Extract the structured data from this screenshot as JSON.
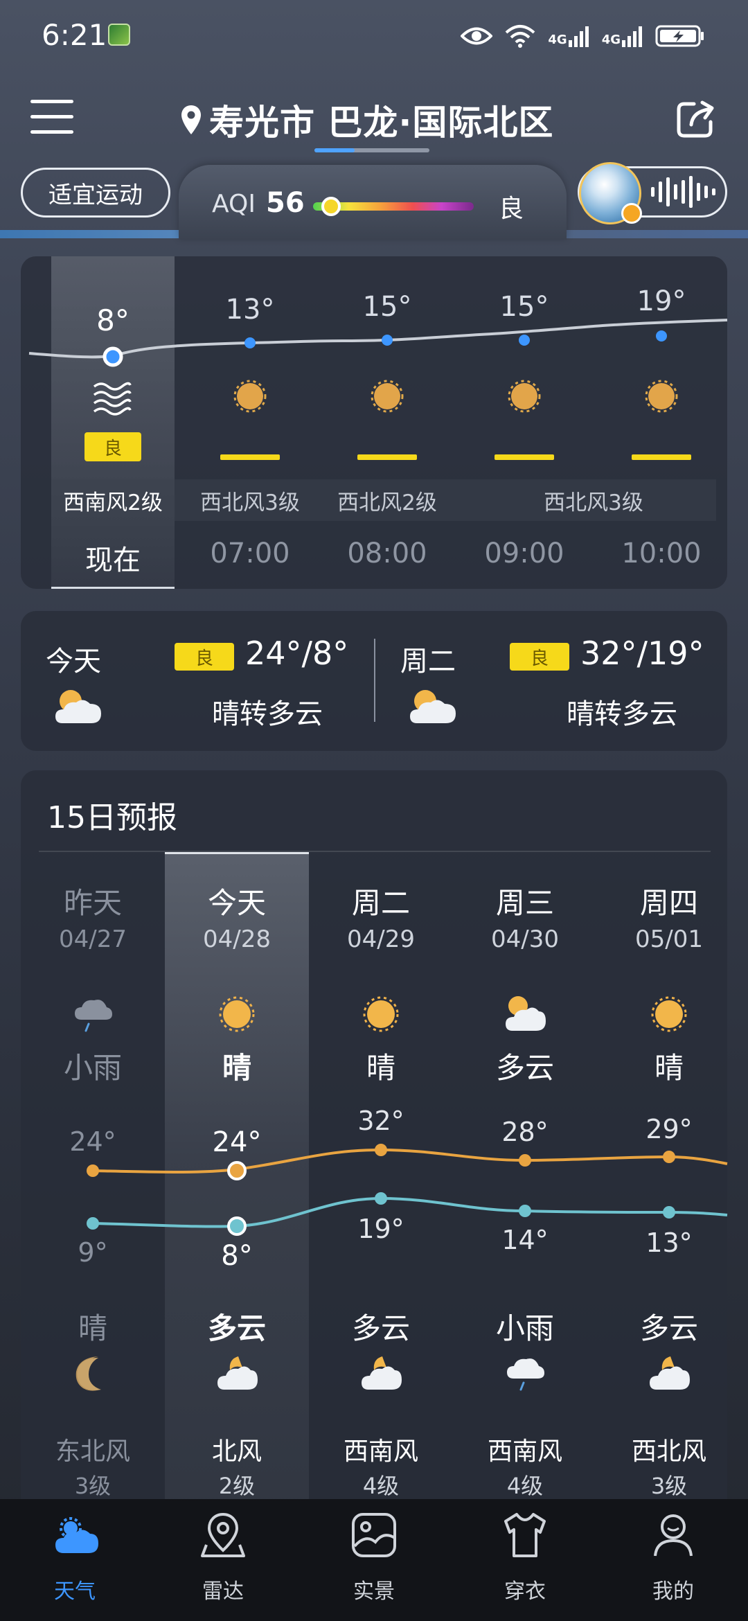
{
  "status_bar": {
    "time": "6:21",
    "network_labels": [
      "4G",
      "4G"
    ],
    "icons": [
      "eye-icon",
      "wifi-icon",
      "signal-icon",
      "signal-icon",
      "battery-charging-icon"
    ]
  },
  "header": {
    "location": "寿光市 巴龙·国际北区",
    "menu_icon": "menu-icon",
    "share_icon": "share-icon"
  },
  "aqi": {
    "sport_label": "适宜运动",
    "label": "AQI",
    "value": "56",
    "level": "良",
    "scale_position": 0.11
  },
  "hourly": {
    "items": [
      {
        "temp": "8°",
        "wind": "西南风2级",
        "time": "现在",
        "aqi": "良",
        "icon": "haze-icon"
      },
      {
        "temp": "13°",
        "wind": "西北风3级",
        "time": "07:00",
        "icon": "sun-icon"
      },
      {
        "temp": "15°",
        "wind": "西北风2级",
        "time": "08:00",
        "icon": "sun-icon"
      },
      {
        "temp": "15°",
        "wind": "西北风3级",
        "time": "09:00",
        "icon": "sun-icon"
      },
      {
        "temp": "19°",
        "time": "10:00",
        "icon": "sun-icon"
      }
    ]
  },
  "summary": {
    "today": {
      "day": "今天",
      "aqi": "良",
      "temp": "24°/8°",
      "condition": "晴转多云"
    },
    "tomorrow": {
      "day": "周二",
      "aqi": "良",
      "temp": "32°/19°",
      "condition": "晴转多云"
    }
  },
  "forecast": {
    "title": "15日预报",
    "days": [
      {
        "day": "昨天",
        "date": "04/27",
        "day_cond": "小雨",
        "high": "24°",
        "low": "9°",
        "night_cond": "晴",
        "wind": "东北风",
        "level": "3级"
      },
      {
        "day": "今天",
        "date": "04/28",
        "day_cond": "晴",
        "high": "24°",
        "low": "8°",
        "night_cond": "多云",
        "wind": "北风",
        "level": "2级"
      },
      {
        "day": "周二",
        "date": "04/29",
        "day_cond": "晴",
        "high": "32°",
        "low": "19°",
        "night_cond": "多云",
        "wind": "西南风",
        "level": "4级"
      },
      {
        "day": "周三",
        "date": "04/30",
        "day_cond": "多云",
        "high": "28°",
        "low": "14°",
        "night_cond": "小雨",
        "wind": "西南风",
        "level": "4级"
      },
      {
        "day": "周四",
        "date": "05/01",
        "day_cond": "晴",
        "high": "29°",
        "low": "13°",
        "night_cond": "多云",
        "wind": "西北风",
        "level": "3级"
      }
    ]
  },
  "bottom_nav": {
    "items": [
      {
        "label": "天气",
        "icon": "weather-icon",
        "active": true
      },
      {
        "label": "雷达",
        "icon": "radar-pin-icon"
      },
      {
        "label": "实景",
        "icon": "photo-icon"
      },
      {
        "label": "穿衣",
        "icon": "shirt-icon"
      },
      {
        "label": "我的",
        "icon": "profile-icon"
      }
    ]
  },
  "colors": {
    "accent": "#3d96ff",
    "aqi_good": "#f6d91a",
    "high_line": "#e9a441",
    "low_line": "#6fc3cf"
  }
}
